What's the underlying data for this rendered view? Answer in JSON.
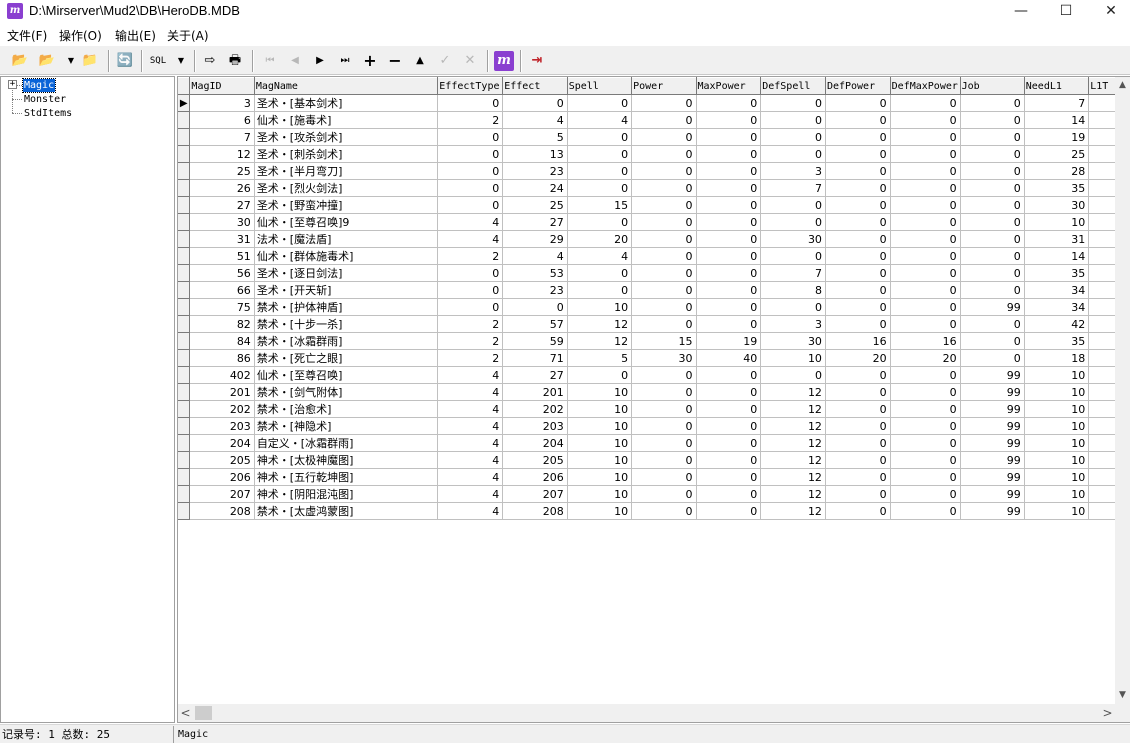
{
  "window": {
    "title": "D:\\Mirserver\\Mud2\\DB\\HeroDB.MDB",
    "app_icon": "m",
    "controls": {
      "minimize": "—",
      "maximize": "☐",
      "close": "✕"
    }
  },
  "menu": [
    {
      "label": "文件(F)"
    },
    {
      "label": "操作(O)"
    },
    {
      "label": "输出(E)"
    },
    {
      "label": "关于(A)"
    }
  ],
  "toolbar": {
    "icons": {
      "open": "📂",
      "open2": "📂",
      "dropdown": "▼",
      "folder": "📁",
      "refresh": "🔄",
      "sql": "SQL",
      "sql_dropdown": "▼",
      "export": "⇨",
      "print": "🖶",
      "first": "⏮",
      "prior": "◀",
      "next": "▶",
      "last": "⏭",
      "insert": "+",
      "delete": "−",
      "edit": "▲",
      "post": "✓",
      "cancel": "✕",
      "app": "m",
      "exit": "⇥"
    }
  },
  "tree": {
    "expander": "+",
    "items": [
      {
        "label": "Magic",
        "selected": true
      },
      {
        "label": "Monster",
        "selected": false
      },
      {
        "label": "StdItems",
        "selected": false
      }
    ]
  },
  "grid": {
    "columns": [
      "MagID",
      "MagName",
      "EffectType",
      "Effect",
      "Spell",
      "Power",
      "MaxPower",
      "DefSpell",
      "DefPower",
      "DefMaxPower",
      "Job",
      "NeedL1",
      "L1T"
    ],
    "current_row_indicator": "▶",
    "rows": [
      [
        "3",
        "圣术・[基本剑术]",
        "0",
        "0",
        "0",
        "0",
        "0",
        "0",
        "0",
        "0",
        "0",
        "7",
        ""
      ],
      [
        "6",
        "仙术・[施毒术]",
        "2",
        "4",
        "4",
        "0",
        "0",
        "0",
        "0",
        "0",
        "0",
        "14",
        ""
      ],
      [
        "7",
        "圣术・[攻杀剑术]",
        "0",
        "5",
        "0",
        "0",
        "0",
        "0",
        "0",
        "0",
        "0",
        "19",
        ""
      ],
      [
        "12",
        "圣术・[刺杀剑术]",
        "0",
        "13",
        "0",
        "0",
        "0",
        "0",
        "0",
        "0",
        "0",
        "25",
        ""
      ],
      [
        "25",
        "圣术・[半月弯刀]",
        "0",
        "23",
        "0",
        "0",
        "0",
        "3",
        "0",
        "0",
        "0",
        "28",
        ""
      ],
      [
        "26",
        "圣术・[烈火剑法]",
        "0",
        "24",
        "0",
        "0",
        "0",
        "7",
        "0",
        "0",
        "0",
        "35",
        ""
      ],
      [
        "27",
        "圣术・[野蛮冲撞]",
        "0",
        "25",
        "15",
        "0",
        "0",
        "0",
        "0",
        "0",
        "0",
        "30",
        ""
      ],
      [
        "30",
        "仙术・[至尊召唤]9",
        "4",
        "27",
        "0",
        "0",
        "0",
        "0",
        "0",
        "0",
        "0",
        "10",
        ""
      ],
      [
        "31",
        "法术・[魔法盾]",
        "4",
        "29",
        "20",
        "0",
        "0",
        "30",
        "0",
        "0",
        "0",
        "31",
        ""
      ],
      [
        "51",
        "仙术・[群体施毒术]",
        "2",
        "4",
        "4",
        "0",
        "0",
        "0",
        "0",
        "0",
        "0",
        "14",
        ""
      ],
      [
        "56",
        "圣术・[逐日剑法]",
        "0",
        "53",
        "0",
        "0",
        "0",
        "7",
        "0",
        "0",
        "0",
        "35",
        ""
      ],
      [
        "66",
        "圣术・[开天斩]",
        "0",
        "23",
        "0",
        "0",
        "0",
        "8",
        "0",
        "0",
        "0",
        "34",
        ""
      ],
      [
        "75",
        "禁术・[护体神盾]",
        "0",
        "0",
        "10",
        "0",
        "0",
        "0",
        "0",
        "0",
        "99",
        "34",
        ""
      ],
      [
        "82",
        "禁术・[十步一杀]",
        "2",
        "57",
        "12",
        "0",
        "0",
        "3",
        "0",
        "0",
        "0",
        "42",
        ""
      ],
      [
        "84",
        "禁术・[冰霜群雨]",
        "2",
        "59",
        "12",
        "15",
        "19",
        "30",
        "16",
        "16",
        "0",
        "35",
        ""
      ],
      [
        "86",
        "禁术・[死亡之眼]",
        "2",
        "71",
        "5",
        "30",
        "40",
        "10",
        "20",
        "20",
        "0",
        "18",
        ""
      ],
      [
        "402",
        "仙术・[至尊召唤]",
        "4",
        "27",
        "0",
        "0",
        "0",
        "0",
        "0",
        "0",
        "99",
        "10",
        ""
      ],
      [
        "201",
        "禁术・[剑气附体]",
        "4",
        "201",
        "10",
        "0",
        "0",
        "12",
        "0",
        "0",
        "99",
        "10",
        ""
      ],
      [
        "202",
        "禁术・[治愈术]",
        "4",
        "202",
        "10",
        "0",
        "0",
        "12",
        "0",
        "0",
        "99",
        "10",
        ""
      ],
      [
        "203",
        "禁术・[神隐术]",
        "4",
        "203",
        "10",
        "0",
        "0",
        "12",
        "0",
        "0",
        "99",
        "10",
        ""
      ],
      [
        "204",
        "自定义・[冰霜群雨]",
        "4",
        "204",
        "10",
        "0",
        "0",
        "12",
        "0",
        "0",
        "99",
        "10",
        ""
      ],
      [
        "205",
        "神术・[太极神魔图]",
        "4",
        "205",
        "10",
        "0",
        "0",
        "12",
        "0",
        "0",
        "99",
        "10",
        ""
      ],
      [
        "206",
        "神术・[五行乾坤图]",
        "4",
        "206",
        "10",
        "0",
        "0",
        "12",
        "0",
        "0",
        "99",
        "10",
        ""
      ],
      [
        "207",
        "神术・[阴阳混沌图]",
        "4",
        "207",
        "10",
        "0",
        "0",
        "12",
        "0",
        "0",
        "99",
        "10",
        ""
      ],
      [
        "208",
        "禁术・[太虚鸿蒙图]",
        "4",
        "208",
        "10",
        "0",
        "0",
        "12",
        "0",
        "0",
        "99",
        "10",
        ""
      ]
    ]
  },
  "scrollbars": {
    "up": "▲",
    "down": "▼",
    "left": "<",
    "right": ">"
  },
  "statusbar": {
    "left": "记录号: 1 总数: 25",
    "right": "Magic"
  },
  "colors": {
    "selection": "#0a64d8",
    "chrome": "#f0f0f0",
    "app_icon": "#8a3fd0"
  }
}
